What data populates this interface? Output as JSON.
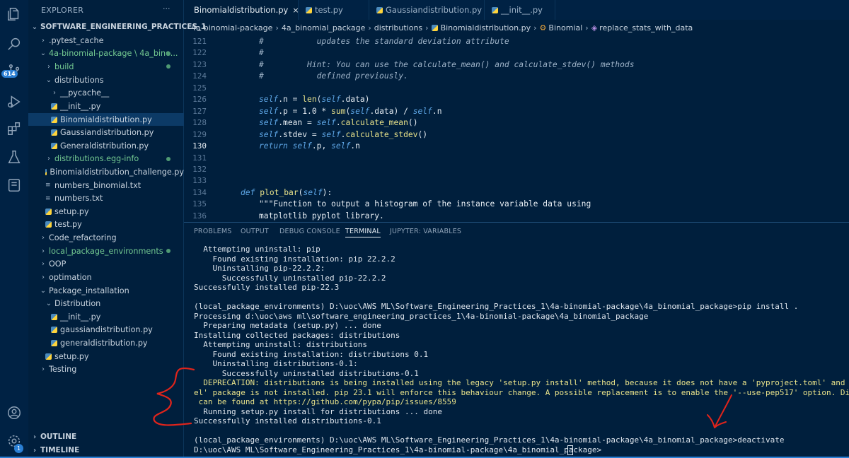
{
  "explorer": {
    "title": "EXPLORER",
    "more": "···",
    "root": "SOFTWARE_ENGINEERING_PRACTICES_1",
    "items": [
      {
        "label": ".pytest_cache",
        "kind": "folder",
        "chev": "›"
      },
      {
        "label": "4a-binomial-package \\ 4a_bino...",
        "kind": "folder-open",
        "chev": "⌄",
        "green": true
      },
      {
        "label": "build",
        "kind": "folder",
        "chev": "›",
        "green": true
      },
      {
        "label": "distributions",
        "kind": "folder-open",
        "chev": "⌄"
      },
      {
        "label": "__pycache__",
        "kind": "folder",
        "chev": "›"
      },
      {
        "label": "__init__.py",
        "kind": "py"
      },
      {
        "label": "Binomialdistribution.py",
        "kind": "py",
        "active": true
      },
      {
        "label": "Gaussiandistribution.py",
        "kind": "py"
      },
      {
        "label": "Generaldistribution.py",
        "kind": "py"
      },
      {
        "label": "distributions.egg-info",
        "kind": "folder",
        "chev": "›",
        "green": true
      },
      {
        "label": "Binomialdistribution_challenge.py",
        "kind": "py"
      },
      {
        "label": "numbers_binomial.txt",
        "kind": "txt"
      },
      {
        "label": "numbers.txt",
        "kind": "txt"
      },
      {
        "label": "setup.py",
        "kind": "py"
      },
      {
        "label": "test.py",
        "kind": "py"
      },
      {
        "label": "Code_refactoring",
        "kind": "folder",
        "chev": "›"
      },
      {
        "label": "local_package_environments",
        "kind": "folder",
        "chev": "›",
        "green": true
      },
      {
        "label": "OOP",
        "kind": "folder",
        "chev": "›"
      },
      {
        "label": "optimation",
        "kind": "folder",
        "chev": "›"
      },
      {
        "label": "Package_installation",
        "kind": "folder-open",
        "chev": "⌄"
      },
      {
        "label": "Distribution",
        "kind": "folder-open",
        "chev": "⌄"
      },
      {
        "label": "__init__.py",
        "kind": "py"
      },
      {
        "label": "gaussiandistribution.py",
        "kind": "py"
      },
      {
        "label": "generaldistribution.py",
        "kind": "py"
      },
      {
        "label": "setup.py",
        "kind": "py"
      },
      {
        "label": "Testing",
        "kind": "folder",
        "chev": "›"
      }
    ],
    "outline": "OUTLINE",
    "timeline": "TIMELINE"
  },
  "activity": {
    "badge_source_control": "614",
    "badge_settings": "1"
  },
  "tabs": [
    {
      "label": "Binomialdistribution.py",
      "active": true,
      "close": "×"
    },
    {
      "label": "test.py"
    },
    {
      "label": "Gaussiandistribution.py"
    },
    {
      "label": "__init__.py"
    }
  ],
  "breadcrumb": [
    "4a-binomial-package",
    "4a_binomial_package",
    "distributions",
    "Binomialdistribution.py",
    "Binomial",
    "replace_stats_with_data"
  ],
  "breadcrumb_sep": "›",
  "editor": {
    "lines": [
      {
        "n": "121",
        "text": "#           updates the standard deviation attribute",
        "cls": "cm"
      },
      {
        "n": "122",
        "text": "#",
        "cls": "cm"
      },
      {
        "n": "123",
        "text": "#         Hint: You can use the calculate_mean() and calculate_stdev() methods",
        "cls": "cm"
      },
      {
        "n": "124",
        "text": "#           defined previously.",
        "cls": "cm"
      },
      {
        "n": "125",
        "text": ""
      },
      {
        "n": "126",
        "text": "self.n = len(self.data)"
      },
      {
        "n": "127",
        "text": "self.p = 1.0 * sum(self.data) / self.n"
      },
      {
        "n": "128",
        "text": "self.mean = self.calculate_mean()"
      },
      {
        "n": "129",
        "text": "self.stdev = self.calculate_stdev()"
      },
      {
        "n": "130",
        "text": "return self.p, self.n",
        "current": true
      },
      {
        "n": "131",
        "text": ""
      },
      {
        "n": "132",
        "text": ""
      },
      {
        "n": "133",
        "text": ""
      },
      {
        "n": "134",
        "text": "def plot_bar(self):"
      },
      {
        "n": "135",
        "text": "\"\"\"Function to output a histogram of the instance variable data using"
      },
      {
        "n": "136",
        "text": "matplotlib pyplot library."
      }
    ]
  },
  "panel": {
    "tabs": [
      "PROBLEMS",
      "OUTPUT",
      "DEBUG CONSOLE",
      "TERMINAL",
      "JUPYTER: VARIABLES"
    ],
    "active_tab": "TERMINAL",
    "terminal_lines": [
      "  Attempting uninstall: pip",
      "    Found existing installation: pip 22.2.2",
      "    Uninstalling pip-22.2.2:",
      "      Successfully uninstalled pip-22.2.2",
      "Successfully installed pip-22.3",
      "",
      "(local_package_environments) D:\\uoc\\AWS ML\\Software_Engineering_Practices_1\\4a-binomial-package\\4a_binomial_package>pip install .",
      "Processing d:\\uoc\\aws ml\\software_engineering_practices_1\\4a-binomial-package\\4a_binomial_package",
      "  Preparing metadata (setup.py) ... done",
      "Installing collected packages: distributions",
      "  Attempting uninstall: distributions",
      "    Found existing installation: distributions 0.1",
      "    Uninstalling distributions-0.1:",
      "      Successfully uninstalled distributions-0.1",
      "  DEPRECATION: distributions is being installed using the legacy 'setup.py install' method, because it does not have a 'pyproject.toml' and the 'whe",
      "el' package is not installed. pip 23.1 will enforce this behaviour change. A possible replacement is to enable the '--use-pep517' option. Discussion",
      " can be found at https://github.com/pypa/pip/issues/8559",
      "  Running setup.py install for distributions ... done",
      "Successfully installed distributions-0.1",
      "",
      "(local_package_environments) D:\\uoc\\AWS ML\\Software_Engineering_Practices_1\\4a-binomial-package\\4a_binomial_package>deactivate",
      "D:\\uoc\\AWS ML\\Software_Engineering_Practices_1\\4a-binomial-package\\4a_binomial_package>"
    ]
  },
  "colors": {
    "annotation": "#e0241b",
    "warning": "#e8e28a",
    "accent": "#2a7fd4"
  }
}
